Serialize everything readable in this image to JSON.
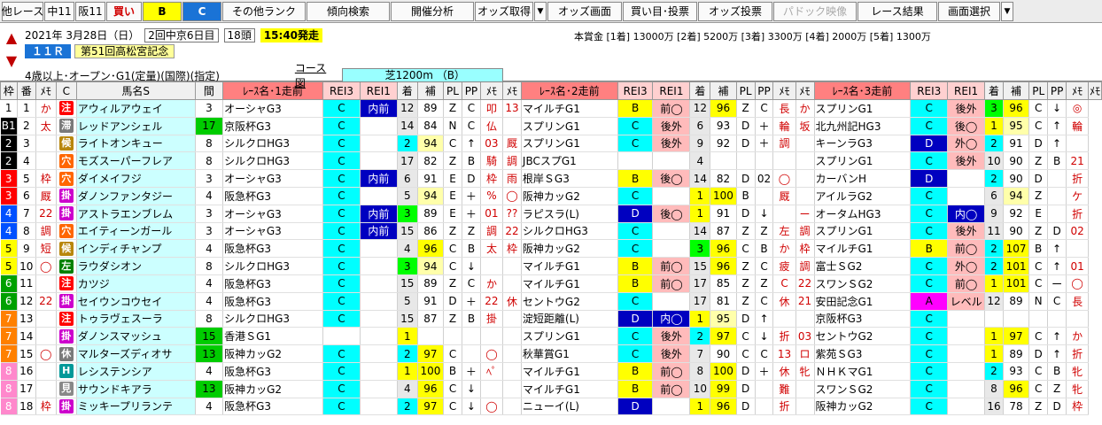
{
  "toolbar": {
    "b0": "他レース",
    "b1": "中11",
    "b2": "阪11",
    "b3": "買い",
    "b4": "B",
    "b5": "C",
    "b6": "その他ランク",
    "b7": "傾向検索",
    "b8": "開催分析",
    "b9": "オッズ取得",
    "b10": "オッズ画面",
    "b11": "買い目･投票",
    "b12": "オッズ投票",
    "b13": "パドック映像",
    "b14": "レース結果",
    "b15": "画面選択",
    "drop": "▼"
  },
  "info": {
    "up": "▲",
    "down": "▼",
    "date": "2021年  3月28日（日）",
    "meet": "2回中京6日目",
    "heads": "18頭",
    "start": "15:40発走",
    "prize": "本賞金 [1着] 13000万 [2着] 5200万 [3着] 3300万 [4着] 2000万 [5着] 1300万",
    "raceno": "１１Ｒ",
    "racename": "第51回高松宮記念",
    "cond": "4歳以上･オープン･G1(定量)(国際)(指定)",
    "course_label": "コース図",
    "course": "芝1200m （B）"
  },
  "headers": [
    "枠",
    "番",
    "ﾒﾓ",
    "C",
    "馬名S",
    "間",
    "ﾚｰｽ名･1走前",
    "REI3",
    "REI1",
    "着",
    "補",
    "PL",
    "PP",
    "ﾒﾓ",
    "ﾒﾓ",
    "ﾚｰｽ名･2走前",
    "REI3",
    "REI1",
    "着",
    "補",
    "PL",
    "PP",
    "ﾒﾓ",
    "ﾒﾓ",
    "ﾚｰｽ名･3走前",
    "REI3",
    "REI1",
    "着",
    "補",
    "PL",
    "PP",
    "ﾒﾓ",
    "ﾒﾓ"
  ],
  "rows": [
    [
      "1",
      "1",
      "か",
      "注",
      "アウィルアウェイ",
      "3",
      "オーシャG3",
      "C",
      "内前",
      "12",
      "89",
      "Z",
      "C",
      "叩",
      "13",
      "マイルチG1",
      "B",
      "前◯",
      "12",
      "96",
      "Z",
      "C",
      "長",
      "か",
      "スプリンG1",
      "C",
      "後外",
      "3",
      "96",
      "C",
      "↓",
      "◎"
    ],
    [
      "B1",
      "2",
      "太",
      "滞",
      "レッドアンシェル",
      "17",
      "京阪杯G3",
      "C",
      "",
      "14",
      "84",
      "N",
      "C",
      "仏",
      "",
      "スプリンG1",
      "C",
      "後外",
      "6",
      "93",
      "D",
      "＋",
      "輪",
      "坂",
      "北九州記HG3",
      "C",
      "後◯",
      "1",
      "95",
      "C",
      "↑",
      "輪"
    ],
    [
      "2",
      "3",
      "",
      "候",
      "ライトオンキュー",
      "8",
      "シルクロHG3",
      "C",
      "",
      "2",
      "94",
      "C",
      "↑",
      "03",
      "厩",
      "スプリンG1",
      "C",
      "後外",
      "9",
      "92",
      "D",
      "＋",
      "調",
      "",
      "キーンラG3",
      "D",
      "外◯",
      "2",
      "91",
      "D",
      "↑",
      ""
    ],
    [
      "2",
      "4",
      "",
      "穴",
      "モズスーパーフレア",
      "8",
      "シルクロHG3",
      "C",
      "",
      "17",
      "82",
      "Z",
      "B",
      "騎",
      "調",
      "JBCスプG1",
      "",
      "",
      "4",
      "",
      "",
      "",
      "",
      "",
      "スプリンG1",
      "C",
      "後外",
      "10",
      "90",
      "Z",
      "B",
      "21"
    ],
    [
      "3",
      "5",
      "枠",
      "穴",
      "ダイメイフジ",
      "3",
      "オーシャG3",
      "C",
      "内前",
      "6",
      "91",
      "E",
      "D",
      "枠",
      "雨",
      "根岸ＳG3",
      "B",
      "後◯",
      "14",
      "82",
      "D",
      "02",
      "◯",
      "",
      "カーバンH",
      "D",
      "",
      "2",
      "90",
      "D",
      "",
      "折"
    ],
    [
      "3",
      "6",
      "厩",
      "掛",
      "ダノンファンタジー",
      "4",
      "阪急杯G3",
      "C",
      "",
      "5",
      "94",
      "E",
      "＋",
      "%",
      "◯",
      "阪神カッG2",
      "C",
      "",
      "1",
      "100",
      "B",
      "",
      "厩",
      "",
      "アイルラG2",
      "C",
      "",
      "6",
      "94",
      "Z",
      "",
      "ケ"
    ],
    [
      "4",
      "7",
      "22",
      "掛",
      "アストラエンブレム",
      "3",
      "オーシャG3",
      "C",
      "内前",
      "3",
      "89",
      "E",
      "＋",
      "01",
      "??",
      "ラピスラ(L)",
      "D",
      "後◯",
      "1",
      "91",
      "D",
      "↓",
      "",
      "ー",
      "オータムHG3",
      "C",
      "内◯",
      "9",
      "92",
      "E",
      "",
      "折"
    ],
    [
      "4",
      "8",
      "調",
      "穴",
      "エイティーンガール",
      "3",
      "オーシャG3",
      "C",
      "内前",
      "15",
      "86",
      "Z",
      "Z",
      "調",
      "22",
      "シルクロHG3",
      "C",
      "",
      "14",
      "87",
      "Z",
      "Z",
      "左",
      "調",
      "スプリンG1",
      "C",
      "後外",
      "11",
      "90",
      "Z",
      "D",
      "02"
    ],
    [
      "5",
      "9",
      "短",
      "候",
      "インディチャンプ",
      "4",
      "阪急杯G3",
      "C",
      "",
      "4",
      "96",
      "C",
      "B",
      "太",
      "枠",
      "阪神カッG2",
      "C",
      "",
      "3",
      "96",
      "C",
      "B",
      "か",
      "枠",
      "マイルチG1",
      "B",
      "前◯",
      "2",
      "107",
      "B",
      "↑",
      ""
    ],
    [
      "5",
      "10",
      "◯",
      "左",
      "ラウダシオン",
      "8",
      "シルクロHG3",
      "C",
      "",
      "3",
      "94",
      "C",
      "↓",
      "",
      "",
      "マイルチG1",
      "B",
      "前◯",
      "15",
      "96",
      "Z",
      "C",
      "疲",
      "調",
      "富士ＳG2",
      "C",
      "外◯",
      "2",
      "101",
      "C",
      "↑",
      "01"
    ],
    [
      "6",
      "11",
      "",
      "注",
      "カツジ",
      "4",
      "阪急杯G3",
      "C",
      "",
      "15",
      "89",
      "Z",
      "C",
      "か",
      "",
      "マイルチG1",
      "B",
      "前◯",
      "17",
      "85",
      "Z",
      "Z",
      "C",
      "22",
      "スワンＳG2",
      "C",
      "前◯",
      "1",
      "101",
      "C",
      "ー",
      "◯"
    ],
    [
      "6",
      "12",
      "22",
      "掛",
      "セイウンコウセイ",
      "4",
      "阪急杯G3",
      "C",
      "",
      "5",
      "91",
      "D",
      "＋",
      "22",
      "休",
      "セントウG2",
      "C",
      "",
      "17",
      "81",
      "Z",
      "C",
      "休",
      "21",
      "安田記念G1",
      "A",
      "レベル",
      "12",
      "89",
      "N",
      "C",
      "長"
    ],
    [
      "7",
      "13",
      "",
      "注",
      "トゥラヴェスーラ",
      "8",
      "シルクロHG3",
      "C",
      "",
      "15",
      "87",
      "Z",
      "B",
      "掛",
      "",
      "淀短距離(L)",
      "D",
      "内◯",
      "1",
      "95",
      "D",
      "↑",
      "",
      "",
      "京阪杯G3",
      "C",
      "",
      "",
      "",
      "",
      "",
      ""
    ],
    [
      "7",
      "14",
      "",
      "掛",
      "ダノンスマッシュ",
      "15",
      "香港ＳG1",
      "",
      "",
      "1",
      "",
      "",
      "",
      "",
      "",
      "スプリンG1",
      "C",
      "後外",
      "2",
      "97",
      "C",
      "↓",
      "折",
      "03",
      "セントウG2",
      "C",
      "",
      "1",
      "97",
      "C",
      "↑",
      "か"
    ],
    [
      "7",
      "15",
      "◯",
      "休",
      "マルターズディオサ",
      "13",
      "阪神カッG2",
      "C",
      "",
      "2",
      "97",
      "C",
      "",
      "◯",
      "",
      "秋華賞G1",
      "C",
      "後外",
      "7",
      "90",
      "C",
      "C",
      "13",
      "ロ",
      "紫苑ＳG3",
      "C",
      "",
      "1",
      "89",
      "D",
      "↑",
      "折"
    ],
    [
      "8",
      "16",
      "",
      "H",
      "レシステンシア",
      "4",
      "阪急杯G3",
      "C",
      "",
      "1",
      "100",
      "B",
      "＋",
      "ﾍﾟ",
      "",
      "マイルチG1",
      "B",
      "前◯",
      "8",
      "100",
      "D",
      "＋",
      "休",
      "牝",
      "ＮＨＫマG1",
      "C",
      "",
      "2",
      "93",
      "C",
      "B",
      "牝"
    ],
    [
      "8",
      "17",
      "",
      "見",
      "サウンドキアラ",
      "13",
      "阪神カッG2",
      "C",
      "",
      "4",
      "96",
      "C",
      "↓",
      "",
      "",
      "マイルチG1",
      "B",
      "前◯",
      "10",
      "99",
      "D",
      "",
      "難",
      "",
      "スワンＳG2",
      "C",
      "",
      "8",
      "96",
      "C",
      "Z",
      "牝"
    ],
    [
      "8",
      "18",
      "枠",
      "掛",
      "ミッキープリランテ",
      "4",
      "阪急杯G3",
      "C",
      "",
      "2",
      "97",
      "C",
      "↓",
      "◯",
      "",
      "ニューイ(L)",
      "D",
      "",
      "1",
      "96",
      "D",
      "",
      "折",
      "",
      "阪神カッG2",
      "C",
      "",
      "16",
      "78",
      "Z",
      "D",
      "枠"
    ]
  ]
}
